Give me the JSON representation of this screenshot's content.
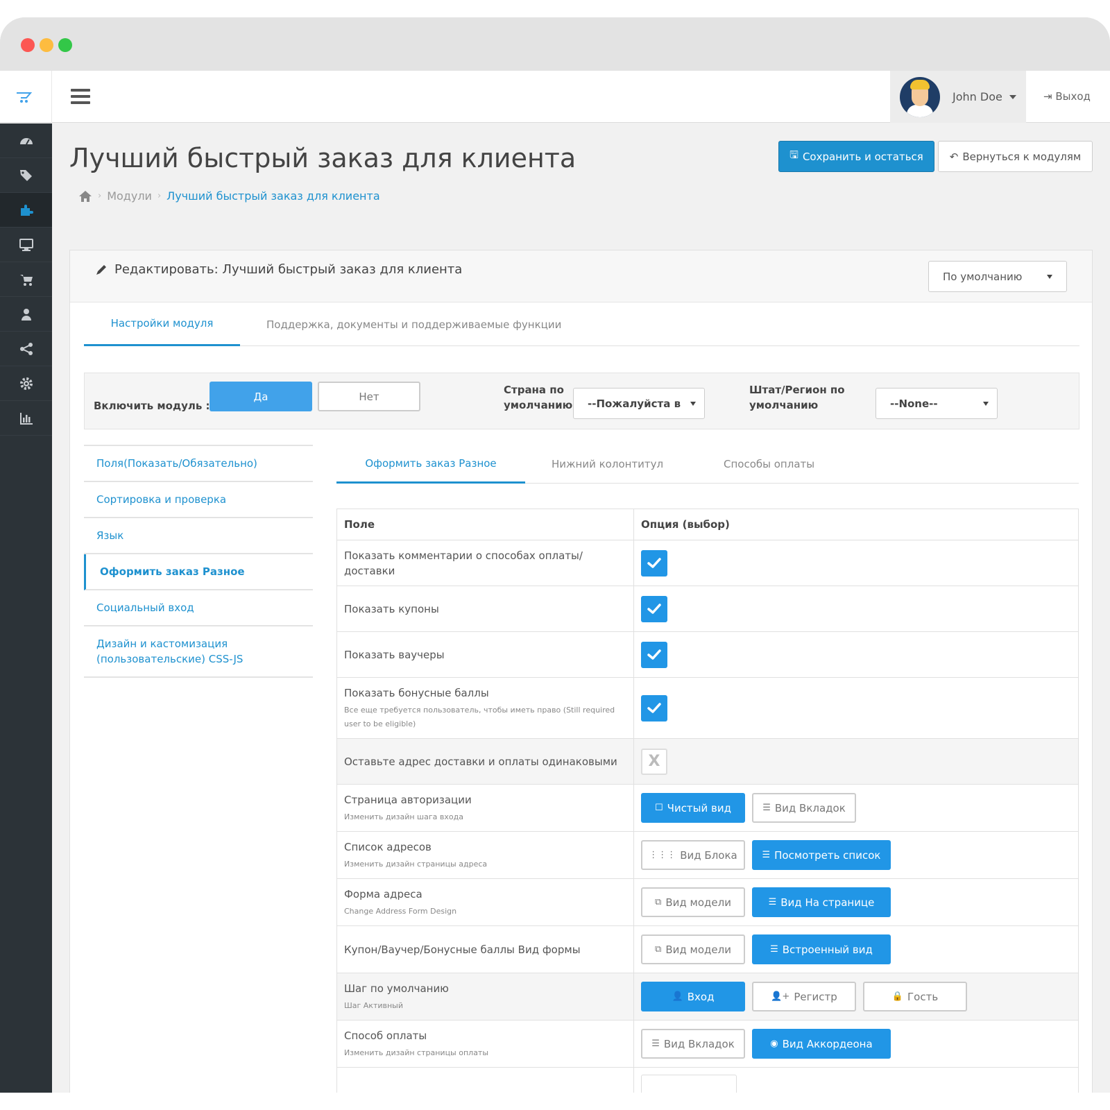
{
  "user": {
    "name": "John Doe",
    "logout_label": "Выход"
  },
  "sidebar": {
    "items": [
      {
        "icon": "dashboard-icon"
      },
      {
        "icon": "tags-icon"
      },
      {
        "icon": "puzzle-icon",
        "active": true
      },
      {
        "icon": "monitor-icon"
      },
      {
        "icon": "cart-icon"
      },
      {
        "icon": "user-icon"
      },
      {
        "icon": "share-icon"
      },
      {
        "icon": "gear-icon"
      },
      {
        "icon": "bar-chart-icon"
      }
    ]
  },
  "page": {
    "title": "Лучший быстрый заказ для клиента",
    "save_label": "Сохранить и остаться",
    "back_label": "Вернуться к модулям",
    "breadcrumb": {
      "modules": "Модули",
      "current": "Лучший быстрый заказ для клиента"
    }
  },
  "panel": {
    "title": "Редактировать: Лучший быстрый заказ для клиента",
    "store_select": "По умолчанию",
    "tabs": [
      "Настройки модуля",
      "Поддержка, документы и поддерживаемые функции"
    ]
  },
  "enable": {
    "label": "Включить модуль :",
    "yes": "Да",
    "no": "Нет",
    "country_label_1": "Страна по",
    "country_label_2": "умолчанию",
    "country_value": "--Пожалуйста в",
    "region_label_1": "Штат/Регион по",
    "region_label_2": "умолчанию",
    "region_value": "--None--"
  },
  "leftnav": [
    "Поля(Показать/Обязательно)",
    "Сортировка и проверка",
    "Язык",
    "Оформить заказ Разное",
    "Социальный вход",
    "Дизайн и кастомизация (пользовательские) CSS-JS"
  ],
  "inner_tabs": [
    "Оформить заказ Разное",
    "Нижний колонтитул",
    "Способы оплаты"
  ],
  "table": {
    "headers": [
      "Поле",
      "Опция (выбор)"
    ],
    "rows": [
      {
        "label": "Показать комментарии о способах оплаты/ доставки",
        "checked": true
      },
      {
        "label": "Показать купоны",
        "checked": true
      },
      {
        "label": "Показать ваучеры",
        "checked": true
      },
      {
        "label": "Показать бонусные баллы",
        "hint": "Все еще требуется пользователь, чтобы иметь право (Still required user to be eligible)",
        "checked": true
      },
      {
        "label": "Оставьте адрес доставки и оплаты одинаковыми",
        "checked": false,
        "off_mark": "X"
      },
      {
        "label": "Страница авторизации",
        "hint": "Изменить дизайн шага входа",
        "options": [
          {
            "label": "Чистый вид",
            "icon": "square-icon",
            "on": true
          },
          {
            "label": "Вид Вкладок",
            "icon": "list-icon",
            "on": false
          }
        ]
      },
      {
        "label": "Список адресов",
        "hint": "Изменить дизайн страницы адреса",
        "options": [
          {
            "label": "Вид Блока",
            "icon": "grid-icon",
            "on": false
          },
          {
            "label": "Посмотреть список",
            "icon": "list-icon",
            "on": true,
            "wide": true
          }
        ]
      },
      {
        "label": "Форма адреса",
        "hint": "Change Address Form Design",
        "options": [
          {
            "label": "Вид модели",
            "icon": "copy-icon",
            "on": false
          },
          {
            "label": "Вид На странице",
            "icon": "list-icon",
            "on": true,
            "wide": true
          }
        ]
      },
      {
        "label": "Купон/Ваучер/Бонусные баллы Вид формы",
        "options": [
          {
            "label": "Вид модели",
            "icon": "copy-icon",
            "on": false
          },
          {
            "label": "Встроенный вид",
            "icon": "list-icon",
            "on": true,
            "wide": true
          }
        ]
      },
      {
        "label": "Шаг по умолчанию",
        "hint": "Шаг Активный",
        "options": [
          {
            "label": "Вход",
            "icon": "user-icon",
            "on": true
          },
          {
            "label": "Регистр",
            "icon": "user-plus-icon",
            "on": false
          },
          {
            "label": "Гость",
            "icon": "lock-icon",
            "on": false
          }
        ]
      },
      {
        "label": "Способ оплаты",
        "hint": "Изменить дизайн страницы оплаты",
        "options": [
          {
            "label": "Вид Вкладок",
            "icon": "list-icon",
            "on": false
          },
          {
            "label": "Вид Аккордеона",
            "icon": "circle-dot-icon",
            "on": true,
            "wide": true
          }
        ]
      }
    ]
  },
  "colors": {
    "accent": "#1e91cf",
    "sidebar": "#2c3338",
    "button_on": "#2196e6"
  }
}
